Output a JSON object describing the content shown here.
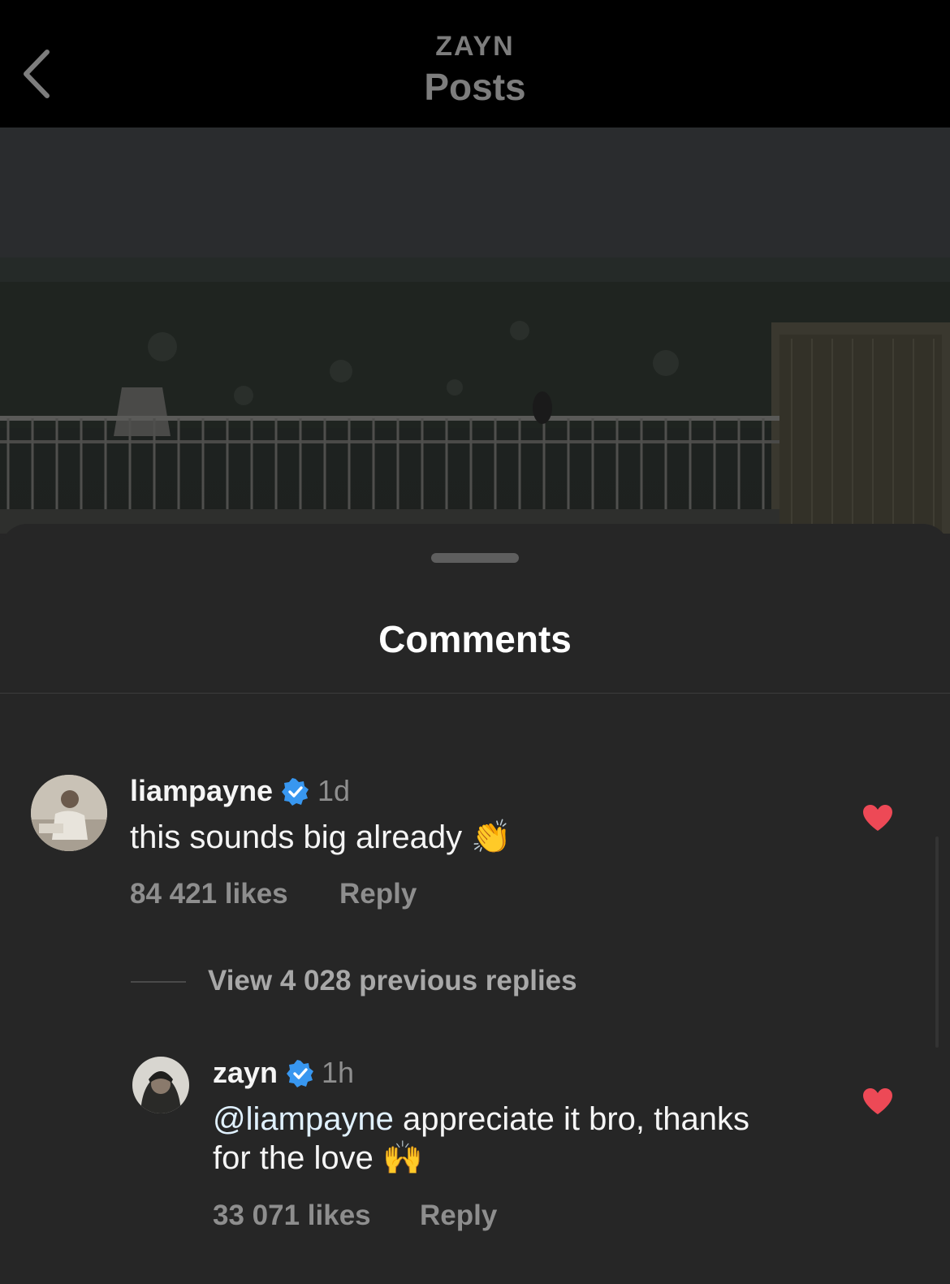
{
  "header": {
    "account": "ZAYN",
    "title": "Posts"
  },
  "sheet": {
    "title": "Comments"
  },
  "comments": [
    {
      "username": "liampayne",
      "time": "1d",
      "text": "this sounds big already",
      "emoji": "👏",
      "likes": "84 421 likes",
      "reply_label": "Reply",
      "liked": true
    }
  ],
  "view_replies_label": "View 4 028 previous replies",
  "replies": [
    {
      "username": "zayn",
      "time": "1h",
      "mention": "@liampayne",
      "text_line1": " appreciate it bro, thanks",
      "text_line2": "for the love",
      "emoji": "🙌",
      "likes": "33 071 likes",
      "reply_label": "Reply",
      "liked": true
    }
  ],
  "colors": {
    "background": "#262626",
    "header": "#000000",
    "heart": "#ed4956",
    "verified": "#3897f0",
    "muted": "#8e8e8e"
  },
  "icons": [
    "back-chevron-icon",
    "verified-badge-icon",
    "heart-filled-icon"
  ]
}
